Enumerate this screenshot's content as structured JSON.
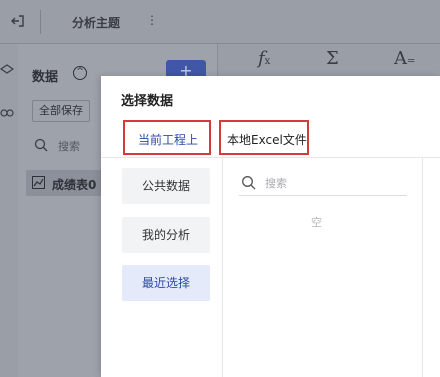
{
  "topbar": {
    "topic": "分析主题",
    "more": "⋮"
  },
  "toolbar": {
    "fx": "f",
    "fx_sub": "x",
    "sum": "Σ",
    "format": "A",
    "format_sub": "="
  },
  "panel": {
    "title": "数据",
    "collapse": "^",
    "add": "+",
    "save_all": "全部保存",
    "search_placeholder": "搜索",
    "table_name": "成绩表0"
  },
  "dialog": {
    "title": "选择数据",
    "tabs": [
      "当前工程上",
      "本地Excel文件"
    ],
    "side_options": [
      "公共数据",
      "我的分析",
      "最近选择"
    ],
    "search_placeholder": "搜索",
    "empty_text": "空"
  },
  "colors": {
    "accent": "#2a4aa6",
    "highlight_border": "#d33a3a",
    "add_button": "#3f57a6"
  }
}
